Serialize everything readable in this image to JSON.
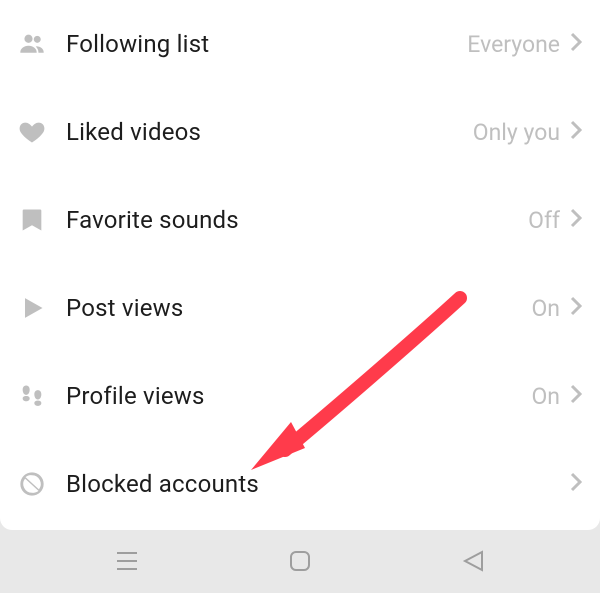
{
  "settings": {
    "items": [
      {
        "icon": "people-icon",
        "label": "Following list",
        "value": "Everyone"
      },
      {
        "icon": "heart-icon",
        "label": "Liked videos",
        "value": "Only you"
      },
      {
        "icon": "bookmark-icon",
        "label": "Favorite sounds",
        "value": "Off"
      },
      {
        "icon": "play-icon",
        "label": "Post views",
        "value": "On"
      },
      {
        "icon": "footprints-icon",
        "label": "Profile views",
        "value": "On"
      },
      {
        "icon": "blocked-icon",
        "label": "Blocked accounts",
        "value": ""
      }
    ]
  },
  "annotation": {
    "arrow_color": "#ff3b4b"
  }
}
